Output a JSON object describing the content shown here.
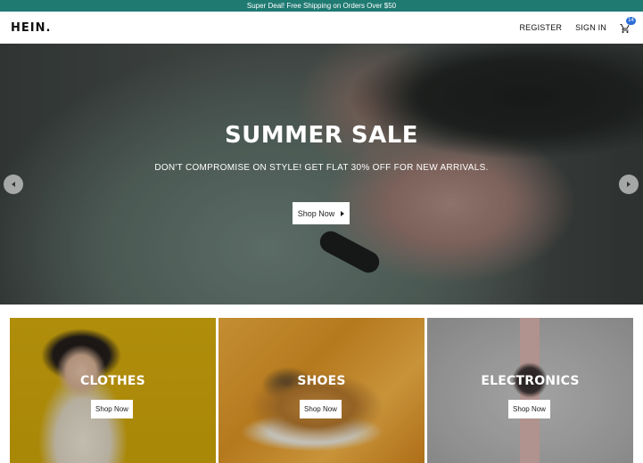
{
  "announcement": {
    "text": "Super Deal! Free Shipping on Orders Over $50"
  },
  "header": {
    "logo": "HEIN.",
    "register_label": "REGISTER",
    "signin_label": "SIGN IN",
    "cart_count": "14",
    "cart_icon": "shopping-cart-icon"
  },
  "hero": {
    "title": "SUMMER SALE",
    "subtitle": "DON'T COMPROMISE ON STYLE! GET FLAT 30% OFF FOR NEW ARRIVALS.",
    "button_label": "Shop Now",
    "prev_icon": "chevron-left-icon",
    "next_icon": "chevron-right-icon"
  },
  "categories": [
    {
      "title": "CLOTHES",
      "button_label": "Shop Now"
    },
    {
      "title": "SHOES",
      "button_label": "Shop Now"
    },
    {
      "title": "ELECTRONICS",
      "button_label": "Shop Now"
    }
  ],
  "colors": {
    "announcement_bg": "#1f7a72",
    "cart_badge": "#2d6fd6"
  }
}
